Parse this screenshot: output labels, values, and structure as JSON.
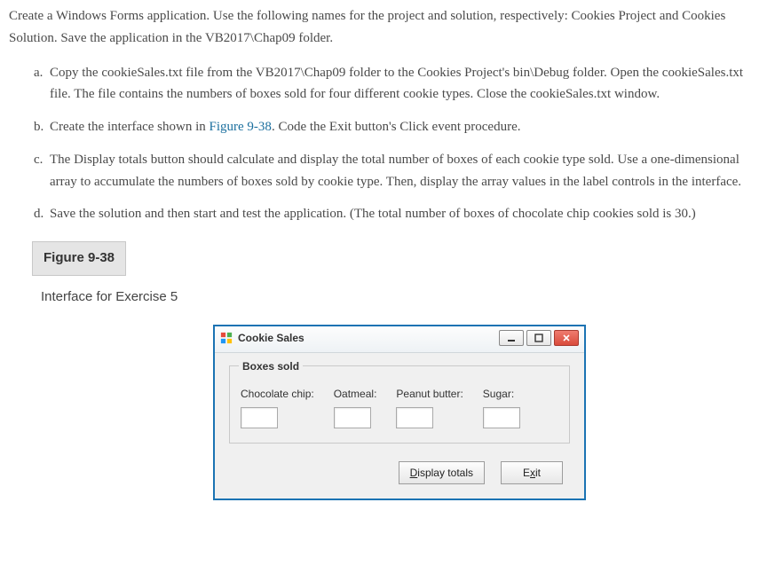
{
  "intro": "Create a Windows Forms application. Use the following names for the project and solution, respectively: Cookies Project and Cookies Solution. Save the application in the VB2017\\Chap09 folder.",
  "items": {
    "a": {
      "letter": "a.",
      "text": "Copy the cookieSales.txt file from the VB2017\\Chap09 folder to the Cookies Project's bin\\Debug folder. Open the cookieSales.txt file. The file contains the numbers of boxes sold for four different cookie types. Close the cookieSales.txt window."
    },
    "b": {
      "letter": "b.",
      "pre": "Create the interface shown in ",
      "figref": "Figure 9-38",
      "post": ". Code the Exit button's Click event procedure."
    },
    "c": {
      "letter": "c.",
      "text": "The Display totals button should calculate and display the total number of boxes of each cookie type sold. Use a one-dimensional array to accumulate the numbers of boxes sold by cookie type. Then, display the array values in the label controls in the interface."
    },
    "d": {
      "letter": "d.",
      "text": "Save the solution and then start and test the application. (The total number of boxes of chocolate chip cookies sold is 30.)"
    }
  },
  "figure": {
    "label": "Figure 9-38",
    "caption": "Interface for Exercise 5"
  },
  "winform": {
    "title": "Cookie Sales",
    "groupbox": "Boxes sold",
    "cookies": {
      "chocchip": "Chocolate chip:",
      "oatmeal": "Oatmeal:",
      "peanut": "Peanut butter:",
      "sugar": "Sugar:"
    },
    "buttons": {
      "display_m": "D",
      "display_rest": "isplay totals",
      "exit_pre": "E",
      "exit_m": "x",
      "exit_post": "it"
    }
  }
}
